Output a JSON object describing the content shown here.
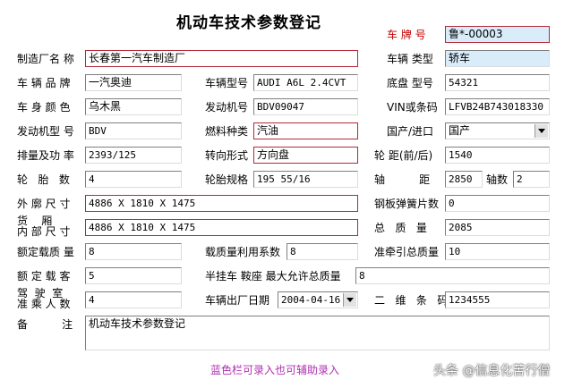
{
  "form": {
    "title": "机动车技术参数登记",
    "hint": "蓝色栏可录入也可辅助录入",
    "watermark": "头条 @信息化苦行僧"
  },
  "plate": {
    "label": "车 牌 号",
    "value": "鲁*-00003"
  },
  "manufacturer": {
    "label": "制造厂名 称",
    "value": "长春第一汽车制造厂"
  },
  "vehicle_class": {
    "label": "车辆 类型",
    "value": "轿车"
  },
  "brand": {
    "label": "车 辆 品 牌",
    "value": "一汽奥迪"
  },
  "model": {
    "label": "车辆型号",
    "value": "AUDI A6L 2.4CVT"
  },
  "chassis_model": {
    "label": "底盘 型号",
    "value": "54321"
  },
  "body_color": {
    "label": "车 身 颜 色",
    "value": "乌木黑"
  },
  "engine_no": {
    "label": "发动机号",
    "value": "BDV09047"
  },
  "vin": {
    "label": "VIN或条码",
    "value": "LFVB24B743018330"
  },
  "engine_model": {
    "label": "发动机型 号",
    "value": "BDV"
  },
  "fuel": {
    "label": "燃料种类",
    "value": "汽油"
  },
  "origin": {
    "label": "国产/进口",
    "value": "国产"
  },
  "displacement_power": {
    "label": "排量及功 率",
    "value": "2393/125"
  },
  "steering": {
    "label": "转向形式",
    "value": "方向盘"
  },
  "wheel_track": {
    "label": "轮 距(前/后)",
    "value": "1540"
  },
  "tire_count": {
    "label": "轮   胎   数",
    "value": "4"
  },
  "tire_spec": {
    "label": "轮胎规格",
    "value": "195 55/16"
  },
  "wheelbase": {
    "label": "轴          距",
    "value": "2850"
  },
  "axle_count": {
    "label": "轴数",
    "value": "2"
  },
  "outer_dim": {
    "label": "外 廓 尺 寸",
    "value": "4886 X 1810 X 1475"
  },
  "leaf_springs": {
    "label": "钢板弹簧片数",
    "value": "0"
  },
  "cargo_dim": {
    "label_top": "货    厢",
    "label_bottom": "内 部 尺 寸",
    "value": "4886 X 1810 X 1475"
  },
  "gross_mass": {
    "label": "总   质   量",
    "value": "2085"
  },
  "rated_load": {
    "label": "额定载质 量",
    "value": "8"
  },
  "load_factor": {
    "label": "载质量利用系数",
    "value": "8"
  },
  "tow_mass": {
    "label": "准牵引总质量",
    "value": "10"
  },
  "rated_passengers": {
    "label": "额 定 载 客",
    "value": "5"
  },
  "saddle": {
    "label": "半挂车 鞍座 最大允许总质量",
    "value": "8"
  },
  "cab_passengers": {
    "label_top": "驾  驶  室",
    "label_bottom": "准 乘 人 数",
    "value": "4"
  },
  "factory_date": {
    "label": "车辆出厂日期",
    "value": "2004-04-16"
  },
  "qr_code": {
    "label": "二   维   条   码",
    "value": "1234555"
  },
  "remarks": {
    "label": "备          注",
    "value": "机动车技术参数登记"
  }
}
